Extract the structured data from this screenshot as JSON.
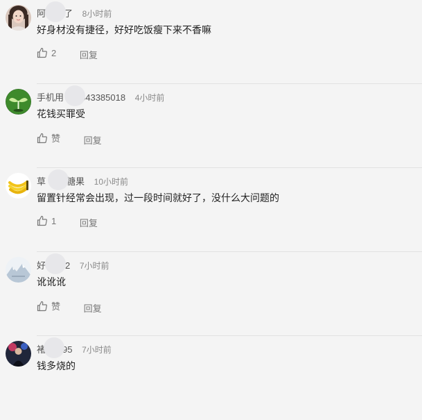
{
  "comments": [
    {
      "user_start": "阿",
      "user_end": "了",
      "time": "8小时前",
      "text": "好身材没有捷径，好好吃饭瘦下来不香嘛",
      "like_label": "2",
      "reply_label": "回复",
      "avatar_icon": "woman-portrait-avatar"
    },
    {
      "user_start": "手机用",
      "user_end": "543385018",
      "time": "4小时前",
      "text": "花钱买罪受",
      "like_label": "赞",
      "reply_label": "回复",
      "avatar_icon": "green-sprout-avatar"
    },
    {
      "user_start": "草",
      "user_end": "糖果",
      "time": "10小时前",
      "text": "留置针经常会出现，过一段时间就好了，没什么大问题的",
      "like_label": "1",
      "reply_label": "回复",
      "avatar_icon": "banana-avatar"
    },
    {
      "user_start": "好",
      "user_end": "2",
      "time": "7小时前",
      "text": "讹讹讹",
      "like_label": "赞",
      "reply_label": "回复",
      "avatar_icon": "snowy-mountain-avatar"
    },
    {
      "user_start": "褚",
      "user_end": "95",
      "time": "7小时前",
      "text": "钱多烧的",
      "like_label": "",
      "reply_label": "",
      "avatar_icon": "dark-figure-avatar"
    }
  ]
}
